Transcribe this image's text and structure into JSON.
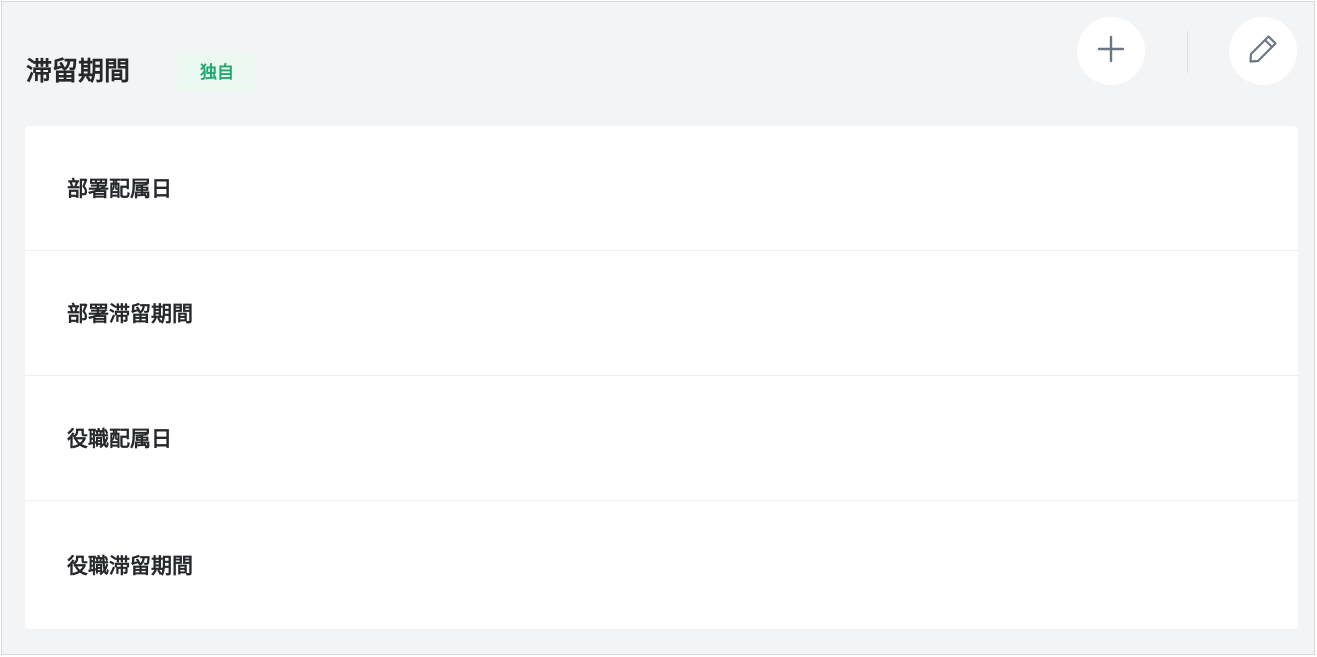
{
  "header": {
    "title": "滞留期間",
    "badge": "独自",
    "add_icon": "plus-icon",
    "edit_icon": "pencil-icon"
  },
  "list": {
    "items": [
      {
        "label": "部署配属日"
      },
      {
        "label": "部署滞留期間"
      },
      {
        "label": "役職配属日"
      },
      {
        "label": "役職滞留期間"
      }
    ]
  },
  "colors": {
    "panel_bg": "#f3f4f6",
    "card_bg": "#ffffff",
    "badge_bg": "#ebf8f2",
    "badge_text": "#1fa870",
    "icon_color": "#6b7782",
    "text": "#26282b"
  }
}
